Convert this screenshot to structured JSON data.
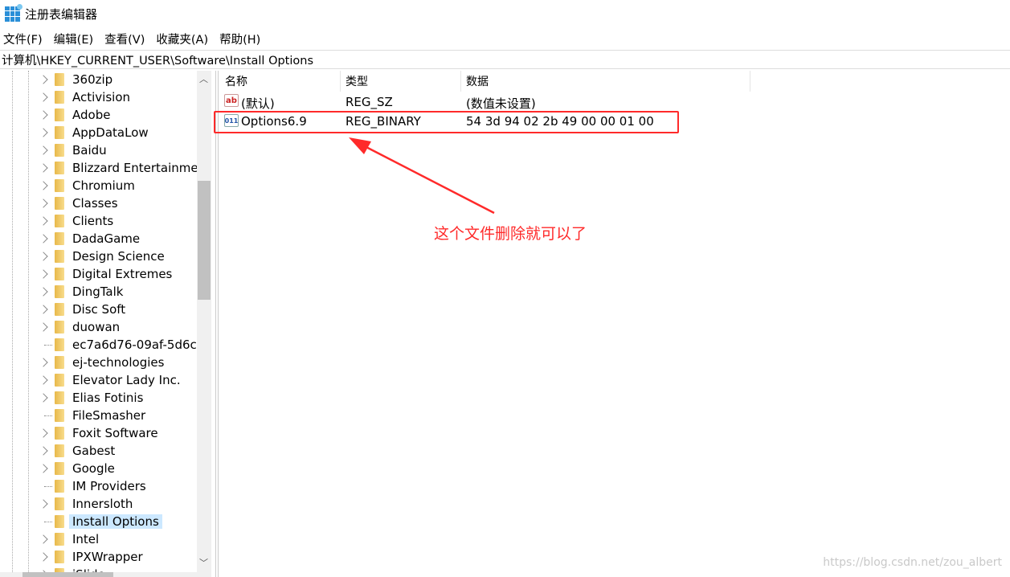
{
  "window": {
    "title": "注册表编辑器"
  },
  "menu": [
    "文件(F)",
    "编辑(E)",
    "查看(V)",
    "收藏夹(A)",
    "帮助(H)"
  ],
  "address": "计算机\\HKEY_CURRENT_USER\\Software\\Install Options",
  "tree": [
    {
      "label": "360zip",
      "expandable": true
    },
    {
      "label": "Activision",
      "expandable": true
    },
    {
      "label": "Adobe",
      "expandable": true
    },
    {
      "label": "AppDataLow",
      "expandable": true
    },
    {
      "label": "Baidu",
      "expandable": true
    },
    {
      "label": "Blizzard Entertainment",
      "expandable": true
    },
    {
      "label": "Chromium",
      "expandable": true
    },
    {
      "label": "Classes",
      "expandable": true
    },
    {
      "label": "Clients",
      "expandable": true
    },
    {
      "label": "DadaGame",
      "expandable": true
    },
    {
      "label": "Design Science",
      "expandable": true
    },
    {
      "label": "Digital Extremes",
      "expandable": true
    },
    {
      "label": "DingTalk",
      "expandable": true
    },
    {
      "label": "Disc Soft",
      "expandable": true
    },
    {
      "label": "duowan",
      "expandable": true
    },
    {
      "label": "ec7a6d76-09af-5d6c-",
      "expandable": false
    },
    {
      "label": "ej-technologies",
      "expandable": true
    },
    {
      "label": "Elevator Lady Inc.",
      "expandable": true
    },
    {
      "label": "Elias Fotinis",
      "expandable": true
    },
    {
      "label": "FileSmasher",
      "expandable": false
    },
    {
      "label": "Foxit Software",
      "expandable": true
    },
    {
      "label": "Gabest",
      "expandable": true
    },
    {
      "label": "Google",
      "expandable": true
    },
    {
      "label": "IM Providers",
      "expandable": false
    },
    {
      "label": "Innersloth",
      "expandable": true
    },
    {
      "label": "Install Options",
      "expandable": false,
      "selected": true
    },
    {
      "label": "Intel",
      "expandable": true
    },
    {
      "label": "IPXWrapper",
      "expandable": true
    },
    {
      "label": "iSlide",
      "expandable": true
    }
  ],
  "list": {
    "columns": [
      "名称",
      "类型",
      "数据"
    ],
    "rows": [
      {
        "name": "(默认)",
        "type": "REG_SZ",
        "data": "(数值未设置)",
        "icon": "ab"
      },
      {
        "name": "Options6.9",
        "type": "REG_BINARY",
        "data": "54 3d 94 02 2b 49 00 00 01 00",
        "icon": "011"
      }
    ]
  },
  "annotation": "这个文件删除就可以了",
  "watermark": "https://blog.csdn.net/zou_albert",
  "colors": {
    "annotation": "#ff2a2a",
    "selection": "#cce8ff"
  }
}
